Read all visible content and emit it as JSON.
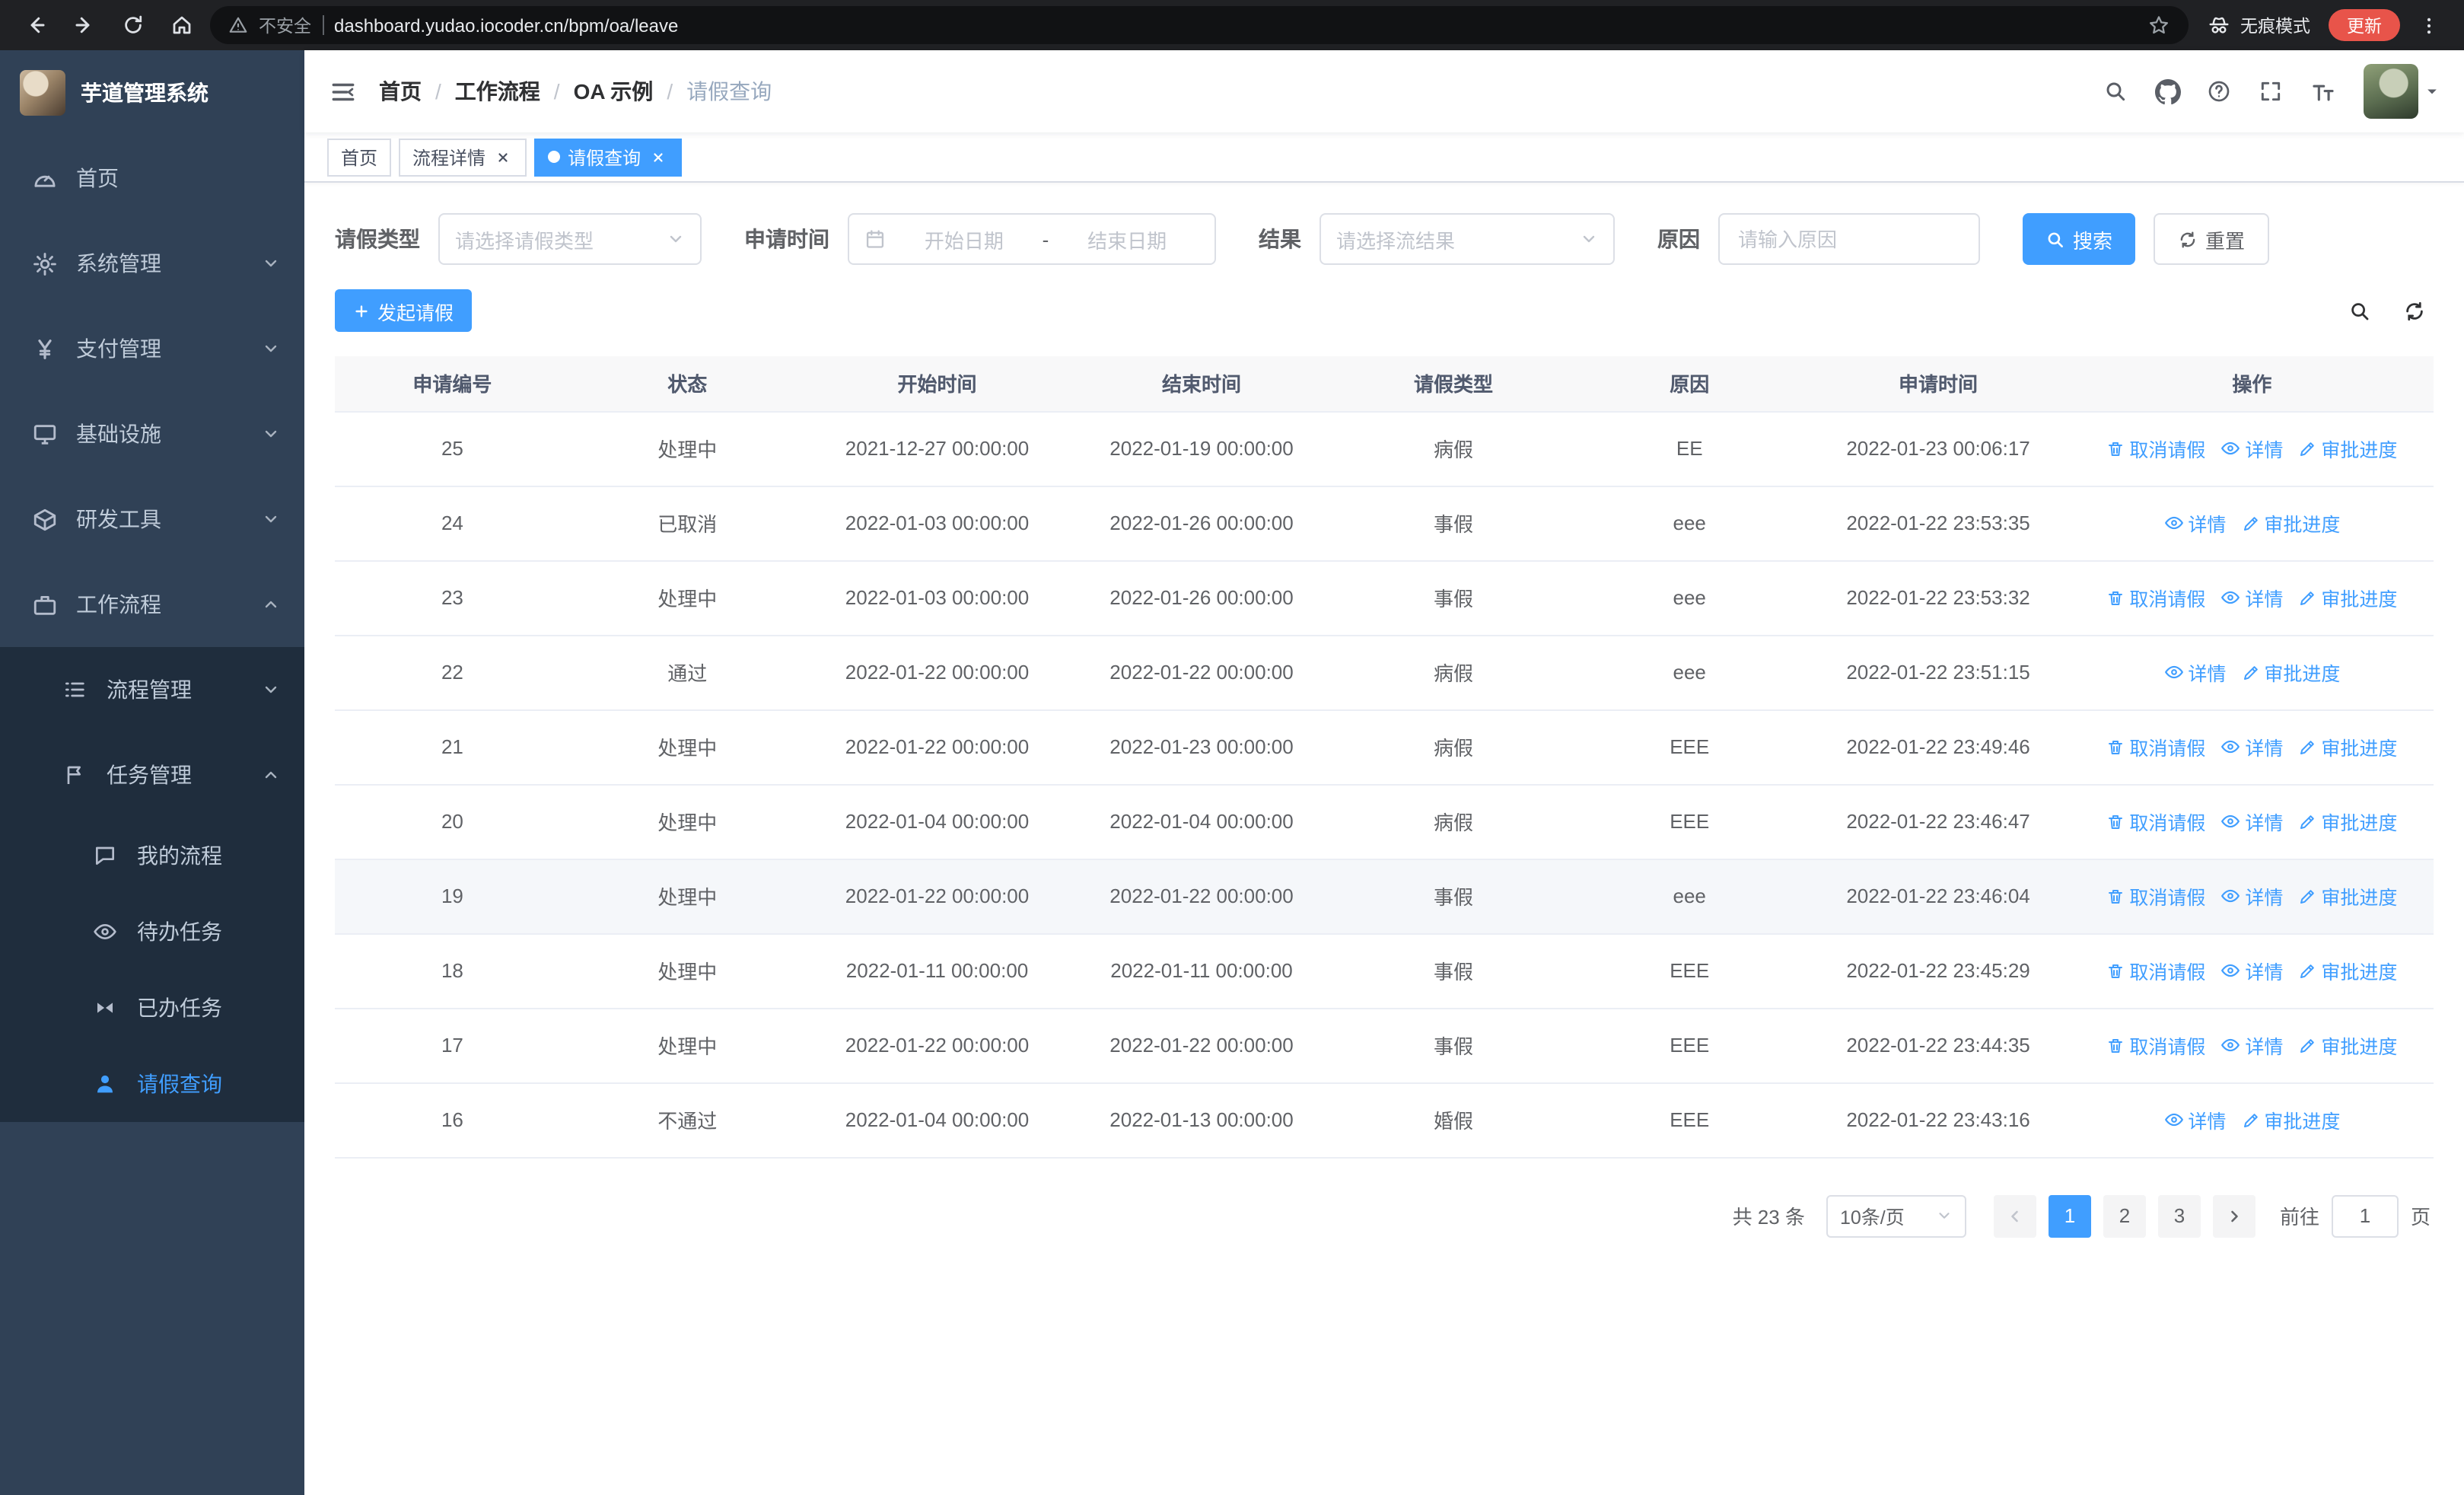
{
  "colors": {
    "accent": "#409eff",
    "sidebar_bg": "#304156",
    "sidebar_submenu_bg": "#1f2d3d",
    "sidebar_text": "#bfcbd9",
    "browser_bar_bg": "#202124",
    "update_pill_bg": "#e8544a",
    "table_header_bg": "#f8f8f9",
    "row_hover_bg": "#f5f7fa"
  },
  "browser": {
    "security_label": "不安全",
    "url": "dashboard.yudao.iocoder.cn/bpm/oa/leave",
    "incognito_label": "无痕模式",
    "update_label": "更新"
  },
  "sidebar": {
    "logo_title": "芋道管理系统",
    "items": [
      {
        "label": "首页"
      },
      {
        "label": "系统管理"
      },
      {
        "label": "支付管理"
      },
      {
        "label": "基础设施"
      },
      {
        "label": "研发工具"
      },
      {
        "label": "工作流程"
      }
    ],
    "submenu": [
      {
        "label": "流程管理"
      },
      {
        "label": "任务管理"
      }
    ],
    "task_items": [
      {
        "label": "我的流程"
      },
      {
        "label": "待办任务"
      },
      {
        "label": "已办任务"
      },
      {
        "label": "请假查询"
      }
    ]
  },
  "header": {
    "breadcrumb": [
      "首页",
      "工作流程",
      "OA 示例",
      "请假查询"
    ],
    "separator": "/"
  },
  "tabs": [
    {
      "label": "首页"
    },
    {
      "label": "流程详情"
    },
    {
      "label": "请假查询"
    }
  ],
  "filters": {
    "leave_type_label": "请假类型",
    "leave_type_placeholder": "请选择请假类型",
    "apply_time_label": "申请时间",
    "start_date_placeholder": "开始日期",
    "range_separator": "-",
    "end_date_placeholder": "结束日期",
    "result_label": "结果",
    "result_placeholder": "请选择流结果",
    "reason_label": "原因",
    "reason_placeholder": "请输入原因",
    "search_button": "搜索",
    "reset_button": "重置"
  },
  "toolbar": {
    "create_button": "发起请假"
  },
  "table": {
    "columns": [
      "申请编号",
      "状态",
      "开始时间",
      "结束时间",
      "请假类型",
      "原因",
      "申请时间",
      "操作"
    ],
    "actions": {
      "cancel": "取消请假",
      "detail": "详情",
      "progress": "审批进度"
    },
    "rows": [
      {
        "id": "25",
        "status": "处理中",
        "start": "2021-12-27 00:00:00",
        "end": "2022-01-19 00:00:00",
        "type": "病假",
        "reason": "EE",
        "applied": "2022-01-23 00:06:17",
        "cancellable": true,
        "hover": false
      },
      {
        "id": "24",
        "status": "已取消",
        "start": "2022-01-03 00:00:00",
        "end": "2022-01-26 00:00:00",
        "type": "事假",
        "reason": "eee",
        "applied": "2022-01-22 23:53:35",
        "cancellable": false,
        "hover": false
      },
      {
        "id": "23",
        "status": "处理中",
        "start": "2022-01-03 00:00:00",
        "end": "2022-01-26 00:00:00",
        "type": "事假",
        "reason": "eee",
        "applied": "2022-01-22 23:53:32",
        "cancellable": true,
        "hover": false
      },
      {
        "id": "22",
        "status": "通过",
        "start": "2022-01-22 00:00:00",
        "end": "2022-01-22 00:00:00",
        "type": "病假",
        "reason": "eee",
        "applied": "2022-01-22 23:51:15",
        "cancellable": false,
        "hover": false
      },
      {
        "id": "21",
        "status": "处理中",
        "start": "2022-01-22 00:00:00",
        "end": "2022-01-23 00:00:00",
        "type": "病假",
        "reason": "EEE",
        "applied": "2022-01-22 23:49:46",
        "cancellable": true,
        "hover": false
      },
      {
        "id": "20",
        "status": "处理中",
        "start": "2022-01-04 00:00:00",
        "end": "2022-01-04 00:00:00",
        "type": "病假",
        "reason": "EEE",
        "applied": "2022-01-22 23:46:47",
        "cancellable": true,
        "hover": false
      },
      {
        "id": "19",
        "status": "处理中",
        "start": "2022-01-22 00:00:00",
        "end": "2022-01-22 00:00:00",
        "type": "事假",
        "reason": "eee",
        "applied": "2022-01-22 23:46:04",
        "cancellable": true,
        "hover": true
      },
      {
        "id": "18",
        "status": "处理中",
        "start": "2022-01-11 00:00:00",
        "end": "2022-01-11 00:00:00",
        "type": "事假",
        "reason": "EEE",
        "applied": "2022-01-22 23:45:29",
        "cancellable": true,
        "hover": false
      },
      {
        "id": "17",
        "status": "处理中",
        "start": "2022-01-22 00:00:00",
        "end": "2022-01-22 00:00:00",
        "type": "事假",
        "reason": "EEE",
        "applied": "2022-01-22 23:44:35",
        "cancellable": true,
        "hover": false
      },
      {
        "id": "16",
        "status": "不通过",
        "start": "2022-01-04 00:00:00",
        "end": "2022-01-13 00:00:00",
        "type": "婚假",
        "reason": "EEE",
        "applied": "2022-01-22 23:43:16",
        "cancellable": false,
        "hover": false
      }
    ]
  },
  "pagination": {
    "total_text": "共 23 条",
    "page_size": "10条/页",
    "pages": [
      "1",
      "2",
      "3"
    ],
    "active_page": "1",
    "goto_label": "前往",
    "goto_value": "1",
    "goto_suffix": "页"
  }
}
